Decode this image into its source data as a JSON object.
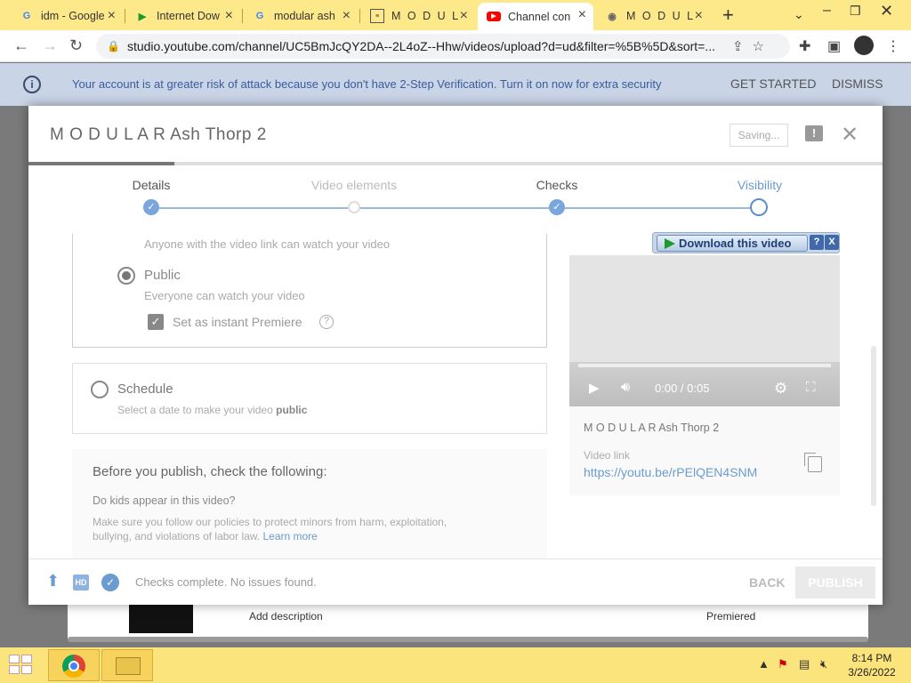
{
  "browser": {
    "tabs": [
      {
        "title": "idm - Google",
        "icon": "google-icon"
      },
      {
        "title": "Internet Dow",
        "icon": "idm-icon"
      },
      {
        "title": "modular ash",
        "icon": "google-icon"
      },
      {
        "title": "M O D U L A",
        "icon": "page-icon"
      },
      {
        "title": "Channel con",
        "icon": "youtube-icon"
      },
      {
        "title": "M O D U L A",
        "icon": "globe-icon"
      }
    ],
    "new_tab": "+",
    "url": "studio.youtube.com/channel/UC5BmJcQY2DA--2L4oZ--Hhw/videos/upload?d=ud&filter=%5B%5D&sort=..."
  },
  "banner": {
    "message": "Your account is at greater risk of attack because you don't have 2-Step Verification. Turn it on now for extra security",
    "get_started": "GET STARTED",
    "dismiss": "DISMISS"
  },
  "modal": {
    "title": "M O D U L A R Ash Thorp 2",
    "saving": "Saving...",
    "steps": [
      {
        "label": "Details",
        "state": "done"
      },
      {
        "label": "Video elements",
        "state": "pending"
      },
      {
        "label": "Checks",
        "state": "done"
      },
      {
        "label": "Visibility",
        "state": "current"
      }
    ],
    "visibility": {
      "unlisted_desc": "Anyone with the video link can watch your video",
      "public_label": "Public",
      "public_desc": "Everyone can watch your video",
      "premiere_label": "Set as instant Premiere",
      "help": "?",
      "schedule_label": "Schedule",
      "schedule_desc_prefix": "Select a date to make your video ",
      "schedule_desc_bold": "public"
    },
    "before": {
      "heading": "Before you publish, check the following:",
      "question": "Do kids appear in this video?",
      "note": "Make sure you follow our policies to protect minors from harm, exploitation, bullying, and violations of labor law.",
      "learn_more": "Learn more"
    },
    "player": {
      "time": "0:00 / 0:05",
      "idm_button": "Download this video",
      "idm_help": "?",
      "idm_close": "X"
    },
    "video_info": {
      "title": "M O D U L A R Ash Thorp 2",
      "link_label": "Video link",
      "link": "https://youtu.be/rPElQEN4SNM"
    },
    "footer": {
      "hd": "HD",
      "status": "Checks complete. No issues found.",
      "back": "BACK",
      "publish": "PUBLISH"
    }
  },
  "background": {
    "add_description": "Add description",
    "premiered": "Premiered"
  },
  "taskbar": {
    "time": "8:14 PM",
    "date": "3/26/2022"
  }
}
